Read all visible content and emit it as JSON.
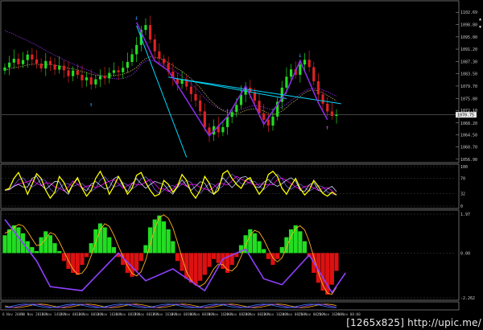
{
  "chart_data": [
    {
      "type": "candlestick",
      "panel": "price",
      "title": "",
      "ylim": [
        1056.86,
        1105.0
      ],
      "y_ticks": [
        "1102.69",
        "1098.80",
        "1095.00",
        "1091.20",
        "1087.30",
        "1083.50",
        "1079.70",
        "1075.80",
        "1072.10",
        "1068.20",
        "1064.50",
        "1060.70",
        "1056.90"
      ],
      "current_price_label": "1070.75",
      "close_series": [
        1085.5,
        1087,
        1088.2,
        1086.5,
        1087.8,
        1089.5,
        1088,
        1086.7,
        1085.2,
        1087.5,
        1086.4,
        1084.8,
        1086,
        1084.6,
        1082.8,
        1084.5,
        1083.2,
        1081.5,
        1082.4,
        1080.2,
        1081.8,
        1082.8,
        1082.1,
        1083.8,
        1084.6,
        1084,
        1085.4,
        1087.2,
        1089.6,
        1092.5,
        1097.2,
        1098.7,
        1094.2,
        1090.5,
        1088.2,
        1086.8,
        1084.2,
        1082.1,
        1080.4,
        1081.8,
        1079.5,
        1077.2,
        1075.2,
        1071.8,
        1066.8,
        1064.6,
        1067.2,
        1065.3,
        1066.9,
        1070.1,
        1071.6,
        1073.8,
        1077,
        1079.2,
        1077.8,
        1075.1,
        1071.2,
        1069.2,
        1067.4,
        1070.2,
        1074.8,
        1079.2,
        1082.6,
        1084.9,
        1083.2,
        1086.4,
        1087.9,
        1085.6,
        1081.2,
        1077.1,
        1074.2,
        1071.8,
        1070.4,
        1070.8
      ],
      "ma_series": [
        {
          "name": "",
          "color": "#8a2be2",
          "values": [
            1097,
            1096.4,
            1095.8,
            1095.1,
            1094.5,
            1093.8,
            1093.1,
            1092.4,
            1091.6,
            1090.8,
            1090,
            1089.3,
            1088.6,
            1087.9,
            1087.2,
            1086.6,
            1086,
            1085.4,
            1084.8,
            1084.2,
            1083.6,
            1083,
            1082.6,
            1082.2,
            1082,
            1081.9,
            1082,
            1082.5,
            1083.2,
            1084.5,
            1086.5,
            1087.5,
            1087.8,
            1087.5,
            1087,
            1086.4,
            1085.6,
            1084.8,
            1083.8,
            1082.8,
            1081.6,
            1080.4,
            1079.1,
            1077.6,
            1076,
            1074.6,
            1073.6,
            1072.8,
            1072.3,
            1072,
            1071.9,
            1072,
            1072.4,
            1072.9,
            1073.4,
            1073.6,
            1073.5,
            1073.1,
            1072.6,
            1072.4,
            1072.6,
            1073.2,
            1074.1,
            1075.2,
            1076.1,
            1077.1,
            1078.1,
            1078.8,
            1079,
            1078.9,
            1078.5,
            1077.9,
            1077.2,
            1076.6
          ]
        },
        {
          "name": "",
          "color": "#b0a060",
          "values": [
            1084.5,
            1085,
            1085.5,
            1085.6,
            1085.9,
            1086.3,
            1086.5,
            1086.5,
            1086.3,
            1086.4,
            1086.4,
            1086.1,
            1086,
            1085.7,
            1085.2,
            1085,
            1084.7,
            1084.2,
            1083.9,
            1083.4,
            1083.1,
            1083,
            1082.8,
            1082.9,
            1083,
            1083.1,
            1083.4,
            1083.9,
            1084.6,
            1085.5,
            1087,
            1088.3,
            1088.8,
            1088.7,
            1088.3,
            1087.8,
            1087,
            1086.1,
            1085.1,
            1084.3,
            1083.2,
            1082,
            1080.7,
            1079.2,
            1077.4,
            1075.6,
            1074.3,
            1073,
            1072,
            1071.5,
            1071.1,
            1071.1,
            1071.5,
            1072.1,
            1072.5,
            1072.6,
            1072.4,
            1071.9,
            1071.2,
            1070.9,
            1071.1,
            1071.9,
            1073,
            1074.3,
            1075.2,
            1076.4,
            1077.6,
            1078.3,
            1078.5,
            1078.2,
            1077.6,
            1076.8,
            1075.9,
            1075.1
          ]
        }
      ],
      "trendlines": [
        {
          "from": [
            29,
            1098.5
          ],
          "to": [
            40,
            1057.5
          ],
          "color": "#00d8ff"
        },
        {
          "from": [
            36,
            1082.5
          ],
          "to": [
            62,
            1075.8
          ],
          "color": "#00d8ff"
        },
        {
          "from": [
            37,
            1082.2
          ],
          "to": [
            74,
            1074.2
          ],
          "color": "#00d8ff"
        }
      ],
      "zigzag": {
        "color": "#8a2be2",
        "points": [
          [
            29,
            1099.5
          ],
          [
            33,
            1087.5
          ],
          [
            36,
            1084.5
          ],
          [
            45,
            1064.2
          ],
          [
            49,
            1070.2
          ],
          [
            53,
            1079.7
          ],
          [
            57,
            1067.8
          ],
          [
            62,
            1078
          ],
          [
            65,
            1087.6
          ],
          [
            69,
            1074.5
          ],
          [
            71,
            1069.2
          ]
        ]
      },
      "up_arrows": [
        [
          19,
          1074.3
        ]
      ],
      "down_arrows": [
        [
          29,
          1100.9
        ],
        [
          65,
          1089.2
        ]
      ],
      "magenta_arrows": [
        [
          71,
          1067.2
        ]
      ]
    },
    {
      "type": "line",
      "panel": "stochastic",
      "title": "",
      "ylim": [
        0,
        100
      ],
      "y_ticks": [
        "100",
        "70",
        "32",
        "0"
      ],
      "main_color": "#ffff00",
      "main": [
        40,
        45,
        70,
        85,
        60,
        30,
        55,
        82,
        70,
        40,
        20,
        35,
        75,
        60,
        35,
        55,
        72,
        45,
        25,
        40,
        70,
        88,
        65,
        30,
        50,
        75,
        55,
        30,
        45,
        78,
        85,
        60,
        40,
        25,
        30,
        65,
        55,
        35,
        50,
        80,
        65,
        35,
        20,
        40,
        75,
        58,
        30,
        40,
        82,
        90,
        70,
        55,
        45,
        65,
        72,
        50,
        30,
        45,
        80,
        88,
        75,
        45,
        30,
        52,
        70,
        45,
        28,
        40,
        65,
        50,
        32,
        25,
        35,
        28
      ],
      "signal_colors": [
        "#6a5acd",
        "#ff00ff",
        "#d0d0ff"
      ]
    },
    {
      "type": "histogram",
      "panel": "oscillator",
      "title": "",
      "ylim": [
        -2.262,
        1.97
      ],
      "y_ticks": [
        "1.97",
        "0.00",
        "-2.262"
      ],
      "values": [
        0.9,
        1.2,
        1.4,
        1.3,
        1.0,
        0.6,
        0.3,
        0.1,
        0.8,
        1.1,
        0.9,
        0.5,
        0.1,
        -0.4,
        -0.8,
        -1.0,
        -1.1,
        -0.6,
        -0.2,
        0.5,
        1.2,
        1.5,
        1.3,
        0.8,
        0.3,
        -0.2,
        -0.6,
        -1.0,
        -1.2,
        -0.9,
        -0.4,
        0.4,
        1.3,
        1.7,
        1.9,
        1.6,
        1.2,
        0.6,
        -0.4,
        -0.9,
        -1.3,
        -1.5,
        -1.6,
        -1.4,
        -1.1,
        -0.7,
        -0.3,
        -0.5,
        -0.8,
        -1.0,
        -0.6,
        -0.2,
        0.4,
        0.9,
        1.2,
        1.0,
        0.6,
        0.2,
        -0.3,
        -0.6,
        -0.3,
        0.3,
        0.8,
        1.2,
        1.4,
        1.1,
        0.6,
        -0.2,
        -1.0,
        -1.5,
        -1.9,
        -2.1,
        -1.6,
        -0.9
      ],
      "pos_color": "#22dd22",
      "neg_color": "#dd1111",
      "zigzag": {
        "color": "#9040ff",
        "points": [
          [
            0,
            1.7
          ],
          [
            7,
            -0.4
          ],
          [
            10,
            -1.7
          ],
          [
            17,
            -1.9
          ],
          [
            25,
            0.0
          ],
          [
            31,
            -1.4
          ],
          [
            37,
            -0.8
          ],
          [
            44,
            -1.9
          ],
          [
            48,
            -0.3
          ],
          [
            53,
            0.2
          ],
          [
            57,
            -1.3
          ],
          [
            61,
            -1.6
          ],
          [
            67,
            -0.1
          ],
          [
            72,
            -2.0
          ],
          [
            75,
            -1.0
          ]
        ]
      }
    }
  ],
  "x_axis_labels": [
    "6 Nov 2009",
    "10 Nov 20:00",
    "11 Nov 14:00",
    "12 Nov 08:00",
    "13 Nov 00:00",
    "13 Nov 16:00",
    "16 Nov 08:00",
    "17 Nov 00:00",
    "17 Nov 16:00",
    "18 Nov 08:00",
    "19 Nov 00:00",
    "19 Nov 16:00",
    "20 Nov 08:00",
    "23 Nov 00:00",
    "23 Nov 16:00",
    "24 Nov 08:00",
    "25 Nov 00:00",
    "25 Nov 16:00",
    "26 Nov 08:00"
  ],
  "watermark": "[1265x825] http://upic.me/"
}
